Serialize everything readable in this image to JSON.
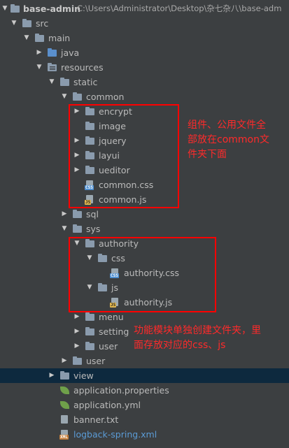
{
  "project": {
    "name": "base-admin",
    "path": "C:\\Users\\Administrator\\Desktop\\杂七杂八\\base-adm"
  },
  "tree": {
    "src": "src",
    "main": "main",
    "java": "java",
    "resources": "resources",
    "static": "static",
    "common": "common",
    "encrypt": "encrypt",
    "image": "image",
    "jquery": "jquery",
    "layui": "layui",
    "ueditor": "ueditor",
    "common_css": "common.css",
    "common_js": "common.js",
    "sql": "sql",
    "sys": "sys",
    "authority": "authority",
    "css": "css",
    "authority_css": "authority.css",
    "js": "js",
    "authority_js": "authority.js",
    "menu": "menu",
    "setting": "setting",
    "user_sys": "user",
    "user": "user",
    "view": "view",
    "application_properties": "application.properties",
    "application_yml": "application.yml",
    "banner_txt": "banner.txt",
    "logback_xml": "logback-spring.xml"
  },
  "badges": {
    "css": "CSS",
    "js": "JS",
    "xml": "XML"
  },
  "annotations": {
    "note1": [
      "组件、公用文件全",
      "部放在common文",
      "件夹下面"
    ],
    "note2": [
      "功能模块单独创建文件夹，里",
      "面存放对应的css、js"
    ]
  },
  "colors": {
    "background": "#3c3f41",
    "selected_row": "#0d293e",
    "annotation": "#ff0000",
    "folder": "#8a9bad",
    "source_folder": "#5a8fcc"
  },
  "icons": {
    "expanded": "triangle-down",
    "collapsed": "triangle-right",
    "folder": "folder-icon",
    "css_file": "css-file-icon",
    "js_file": "js-file-icon",
    "spring_config": "spring-leaf-icon",
    "text_file": "text-file-icon",
    "xml_file": "xml-file-icon"
  }
}
